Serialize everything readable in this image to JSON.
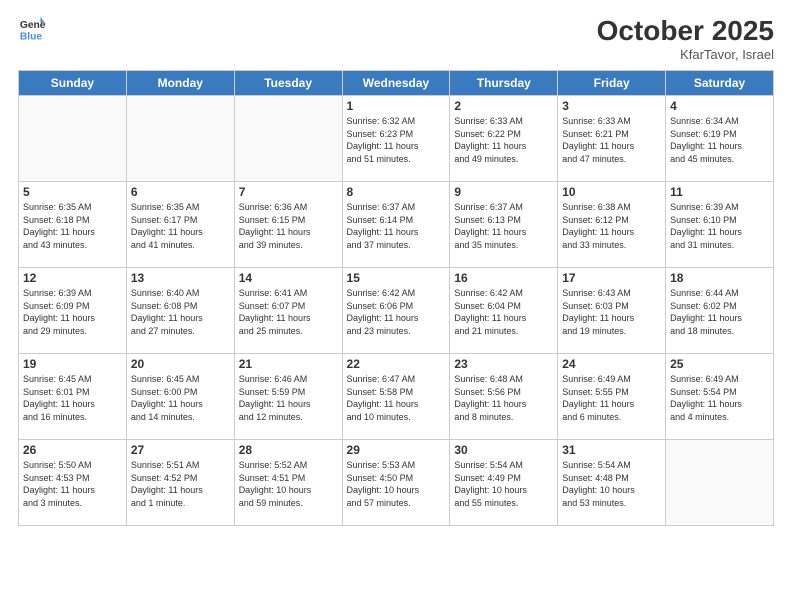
{
  "header": {
    "logo_line1": "General",
    "logo_line2": "Blue",
    "month": "October 2025",
    "location": "KfarTavor, Israel"
  },
  "weekdays": [
    "Sunday",
    "Monday",
    "Tuesday",
    "Wednesday",
    "Thursday",
    "Friday",
    "Saturday"
  ],
  "weeks": [
    [
      {
        "day": "",
        "info": ""
      },
      {
        "day": "",
        "info": ""
      },
      {
        "day": "",
        "info": ""
      },
      {
        "day": "1",
        "info": "Sunrise: 6:32 AM\nSunset: 6:23 PM\nDaylight: 11 hours\nand 51 minutes."
      },
      {
        "day": "2",
        "info": "Sunrise: 6:33 AM\nSunset: 6:22 PM\nDaylight: 11 hours\nand 49 minutes."
      },
      {
        "day": "3",
        "info": "Sunrise: 6:33 AM\nSunset: 6:21 PM\nDaylight: 11 hours\nand 47 minutes."
      },
      {
        "day": "4",
        "info": "Sunrise: 6:34 AM\nSunset: 6:19 PM\nDaylight: 11 hours\nand 45 minutes."
      }
    ],
    [
      {
        "day": "5",
        "info": "Sunrise: 6:35 AM\nSunset: 6:18 PM\nDaylight: 11 hours\nand 43 minutes."
      },
      {
        "day": "6",
        "info": "Sunrise: 6:35 AM\nSunset: 6:17 PM\nDaylight: 11 hours\nand 41 minutes."
      },
      {
        "day": "7",
        "info": "Sunrise: 6:36 AM\nSunset: 6:15 PM\nDaylight: 11 hours\nand 39 minutes."
      },
      {
        "day": "8",
        "info": "Sunrise: 6:37 AM\nSunset: 6:14 PM\nDaylight: 11 hours\nand 37 minutes."
      },
      {
        "day": "9",
        "info": "Sunrise: 6:37 AM\nSunset: 6:13 PM\nDaylight: 11 hours\nand 35 minutes."
      },
      {
        "day": "10",
        "info": "Sunrise: 6:38 AM\nSunset: 6:12 PM\nDaylight: 11 hours\nand 33 minutes."
      },
      {
        "day": "11",
        "info": "Sunrise: 6:39 AM\nSunset: 6:10 PM\nDaylight: 11 hours\nand 31 minutes."
      }
    ],
    [
      {
        "day": "12",
        "info": "Sunrise: 6:39 AM\nSunset: 6:09 PM\nDaylight: 11 hours\nand 29 minutes."
      },
      {
        "day": "13",
        "info": "Sunrise: 6:40 AM\nSunset: 6:08 PM\nDaylight: 11 hours\nand 27 minutes."
      },
      {
        "day": "14",
        "info": "Sunrise: 6:41 AM\nSunset: 6:07 PM\nDaylight: 11 hours\nand 25 minutes."
      },
      {
        "day": "15",
        "info": "Sunrise: 6:42 AM\nSunset: 6:06 PM\nDaylight: 11 hours\nand 23 minutes."
      },
      {
        "day": "16",
        "info": "Sunrise: 6:42 AM\nSunset: 6:04 PM\nDaylight: 11 hours\nand 21 minutes."
      },
      {
        "day": "17",
        "info": "Sunrise: 6:43 AM\nSunset: 6:03 PM\nDaylight: 11 hours\nand 19 minutes."
      },
      {
        "day": "18",
        "info": "Sunrise: 6:44 AM\nSunset: 6:02 PM\nDaylight: 11 hours\nand 18 minutes."
      }
    ],
    [
      {
        "day": "19",
        "info": "Sunrise: 6:45 AM\nSunset: 6:01 PM\nDaylight: 11 hours\nand 16 minutes."
      },
      {
        "day": "20",
        "info": "Sunrise: 6:45 AM\nSunset: 6:00 PM\nDaylight: 11 hours\nand 14 minutes."
      },
      {
        "day": "21",
        "info": "Sunrise: 6:46 AM\nSunset: 5:59 PM\nDaylight: 11 hours\nand 12 minutes."
      },
      {
        "day": "22",
        "info": "Sunrise: 6:47 AM\nSunset: 5:58 PM\nDaylight: 11 hours\nand 10 minutes."
      },
      {
        "day": "23",
        "info": "Sunrise: 6:48 AM\nSunset: 5:56 PM\nDaylight: 11 hours\nand 8 minutes."
      },
      {
        "day": "24",
        "info": "Sunrise: 6:49 AM\nSunset: 5:55 PM\nDaylight: 11 hours\nand 6 minutes."
      },
      {
        "day": "25",
        "info": "Sunrise: 6:49 AM\nSunset: 5:54 PM\nDaylight: 11 hours\nand 4 minutes."
      }
    ],
    [
      {
        "day": "26",
        "info": "Sunrise: 5:50 AM\nSunset: 4:53 PM\nDaylight: 11 hours\nand 3 minutes."
      },
      {
        "day": "27",
        "info": "Sunrise: 5:51 AM\nSunset: 4:52 PM\nDaylight: 11 hours\nand 1 minute."
      },
      {
        "day": "28",
        "info": "Sunrise: 5:52 AM\nSunset: 4:51 PM\nDaylight: 10 hours\nand 59 minutes."
      },
      {
        "day": "29",
        "info": "Sunrise: 5:53 AM\nSunset: 4:50 PM\nDaylight: 10 hours\nand 57 minutes."
      },
      {
        "day": "30",
        "info": "Sunrise: 5:54 AM\nSunset: 4:49 PM\nDaylight: 10 hours\nand 55 minutes."
      },
      {
        "day": "31",
        "info": "Sunrise: 5:54 AM\nSunset: 4:48 PM\nDaylight: 10 hours\nand 53 minutes."
      },
      {
        "day": "",
        "info": ""
      }
    ]
  ]
}
